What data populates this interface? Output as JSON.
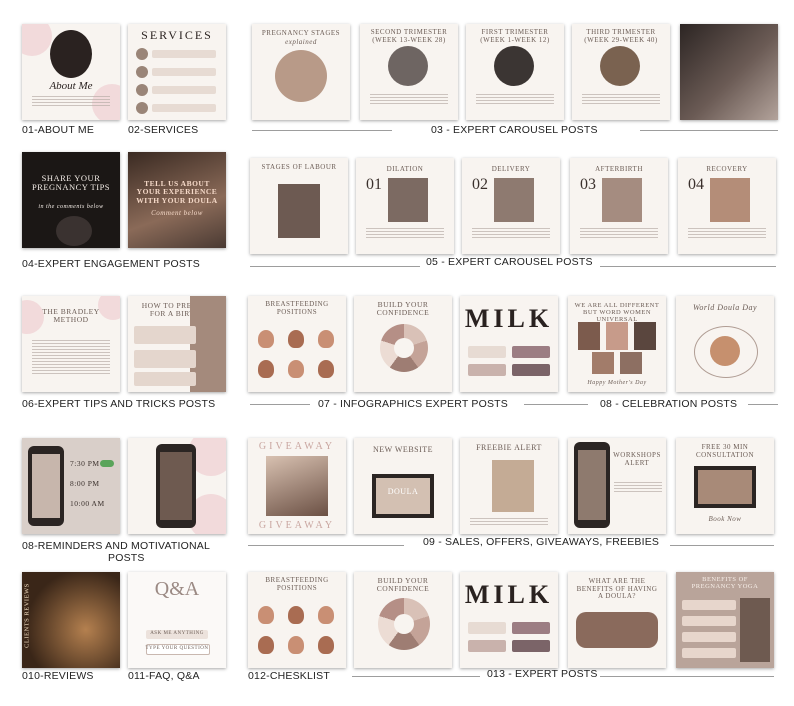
{
  "captions": {
    "c01": "01-ABOUT ME",
    "c02": "02-SERVICES",
    "c03": "03 - EXPERT CAROUSEL POSTS",
    "c04": "04-EXPERT ENGAGEMENT POSTS",
    "c05": "05 - EXPERT CAROUSEL POSTS",
    "c06": "06-EXPERT TIPS AND TRICKS POSTS",
    "c07": "07 - INFOGRAPHICS EXPERT POSTS",
    "c08a": "08 - CELEBRATION POSTS",
    "c08b": "08-REMINDERS AND MOTIVATIONAL POSTS",
    "c09": "09 - SALES, OFFERS, GIVEAWAYS, FREEBIES",
    "c10": "010-REVIEWS",
    "c11": "011-FAQ, Q&A",
    "c12": "012-CHESKLIST",
    "c13": "013 - EXPERT POSTS"
  },
  "tiles": {
    "about_me": "About Me",
    "services": "SERVICES",
    "preg_stages": "PREGNANCY STAGES",
    "preg_stages_sub": "explained",
    "second_tri": "SECOND TRIMESTER (WEEK 13-WEEK 28)",
    "first_tri": "FIRST TRIMESTER (WEEK 1-WEEK 12)",
    "third_tri": "THIRD TRIMESTER (WEEK 29-WEEK 40)",
    "share_tips": "SHARE YOUR PREGNANCY TIPS",
    "share_sub": "in the comments below",
    "tell_us": "TELL US ABOUT YOUR EXPERIENCE WITH YOUR DOULA",
    "tell_sub": "Comment below",
    "stages_labour": "STAGES OF LABOUR",
    "dilation": "DILATION",
    "delivery": "DELIVERY",
    "afterbirth": "AFTERBIRTH",
    "recovery": "RECOVERY",
    "n01": "01",
    "n02": "02",
    "n03": "03",
    "n04": "04",
    "bradley": "THE BRADLEY METHOD",
    "prepare": "HOW TO PREPARE FOR A BIRTH?",
    "bf_positions": "BREASTFEEDING POSITIONS",
    "build_conf": "BUILD YOUR CONFIDENCE",
    "milk": "MILK",
    "all_different": "WE ARE ALL DIFFERENT BUT WORD WOMEN UNIVERSAL",
    "mothers_day": "Happy Mother's Day",
    "world_doula": "World Doula Day",
    "t1": "7:30 PM",
    "t2": "8:00 PM",
    "t3": "10:00 AM",
    "giveaway": "GIVEAWAY",
    "new_website": "NEW WEBSITE",
    "doula": "DOULA",
    "freebie": "FREEBIE ALERT",
    "workshop": "WORKSHOPS Alert",
    "free_consult": "FREE 30 MIN CONSULTATION",
    "book_now": "Book Now",
    "reviews": "CLIENTS REVIEWS",
    "qa": "Q&A",
    "ask": "ASK ME ANYTHING",
    "type_q": "TYPE YOUR QUESTION",
    "benefits": "WHAT ARE THE BENEFITS of having a Doula?",
    "benefits_preg": "BENEFITS OF PREGNANCY YOGA"
  }
}
